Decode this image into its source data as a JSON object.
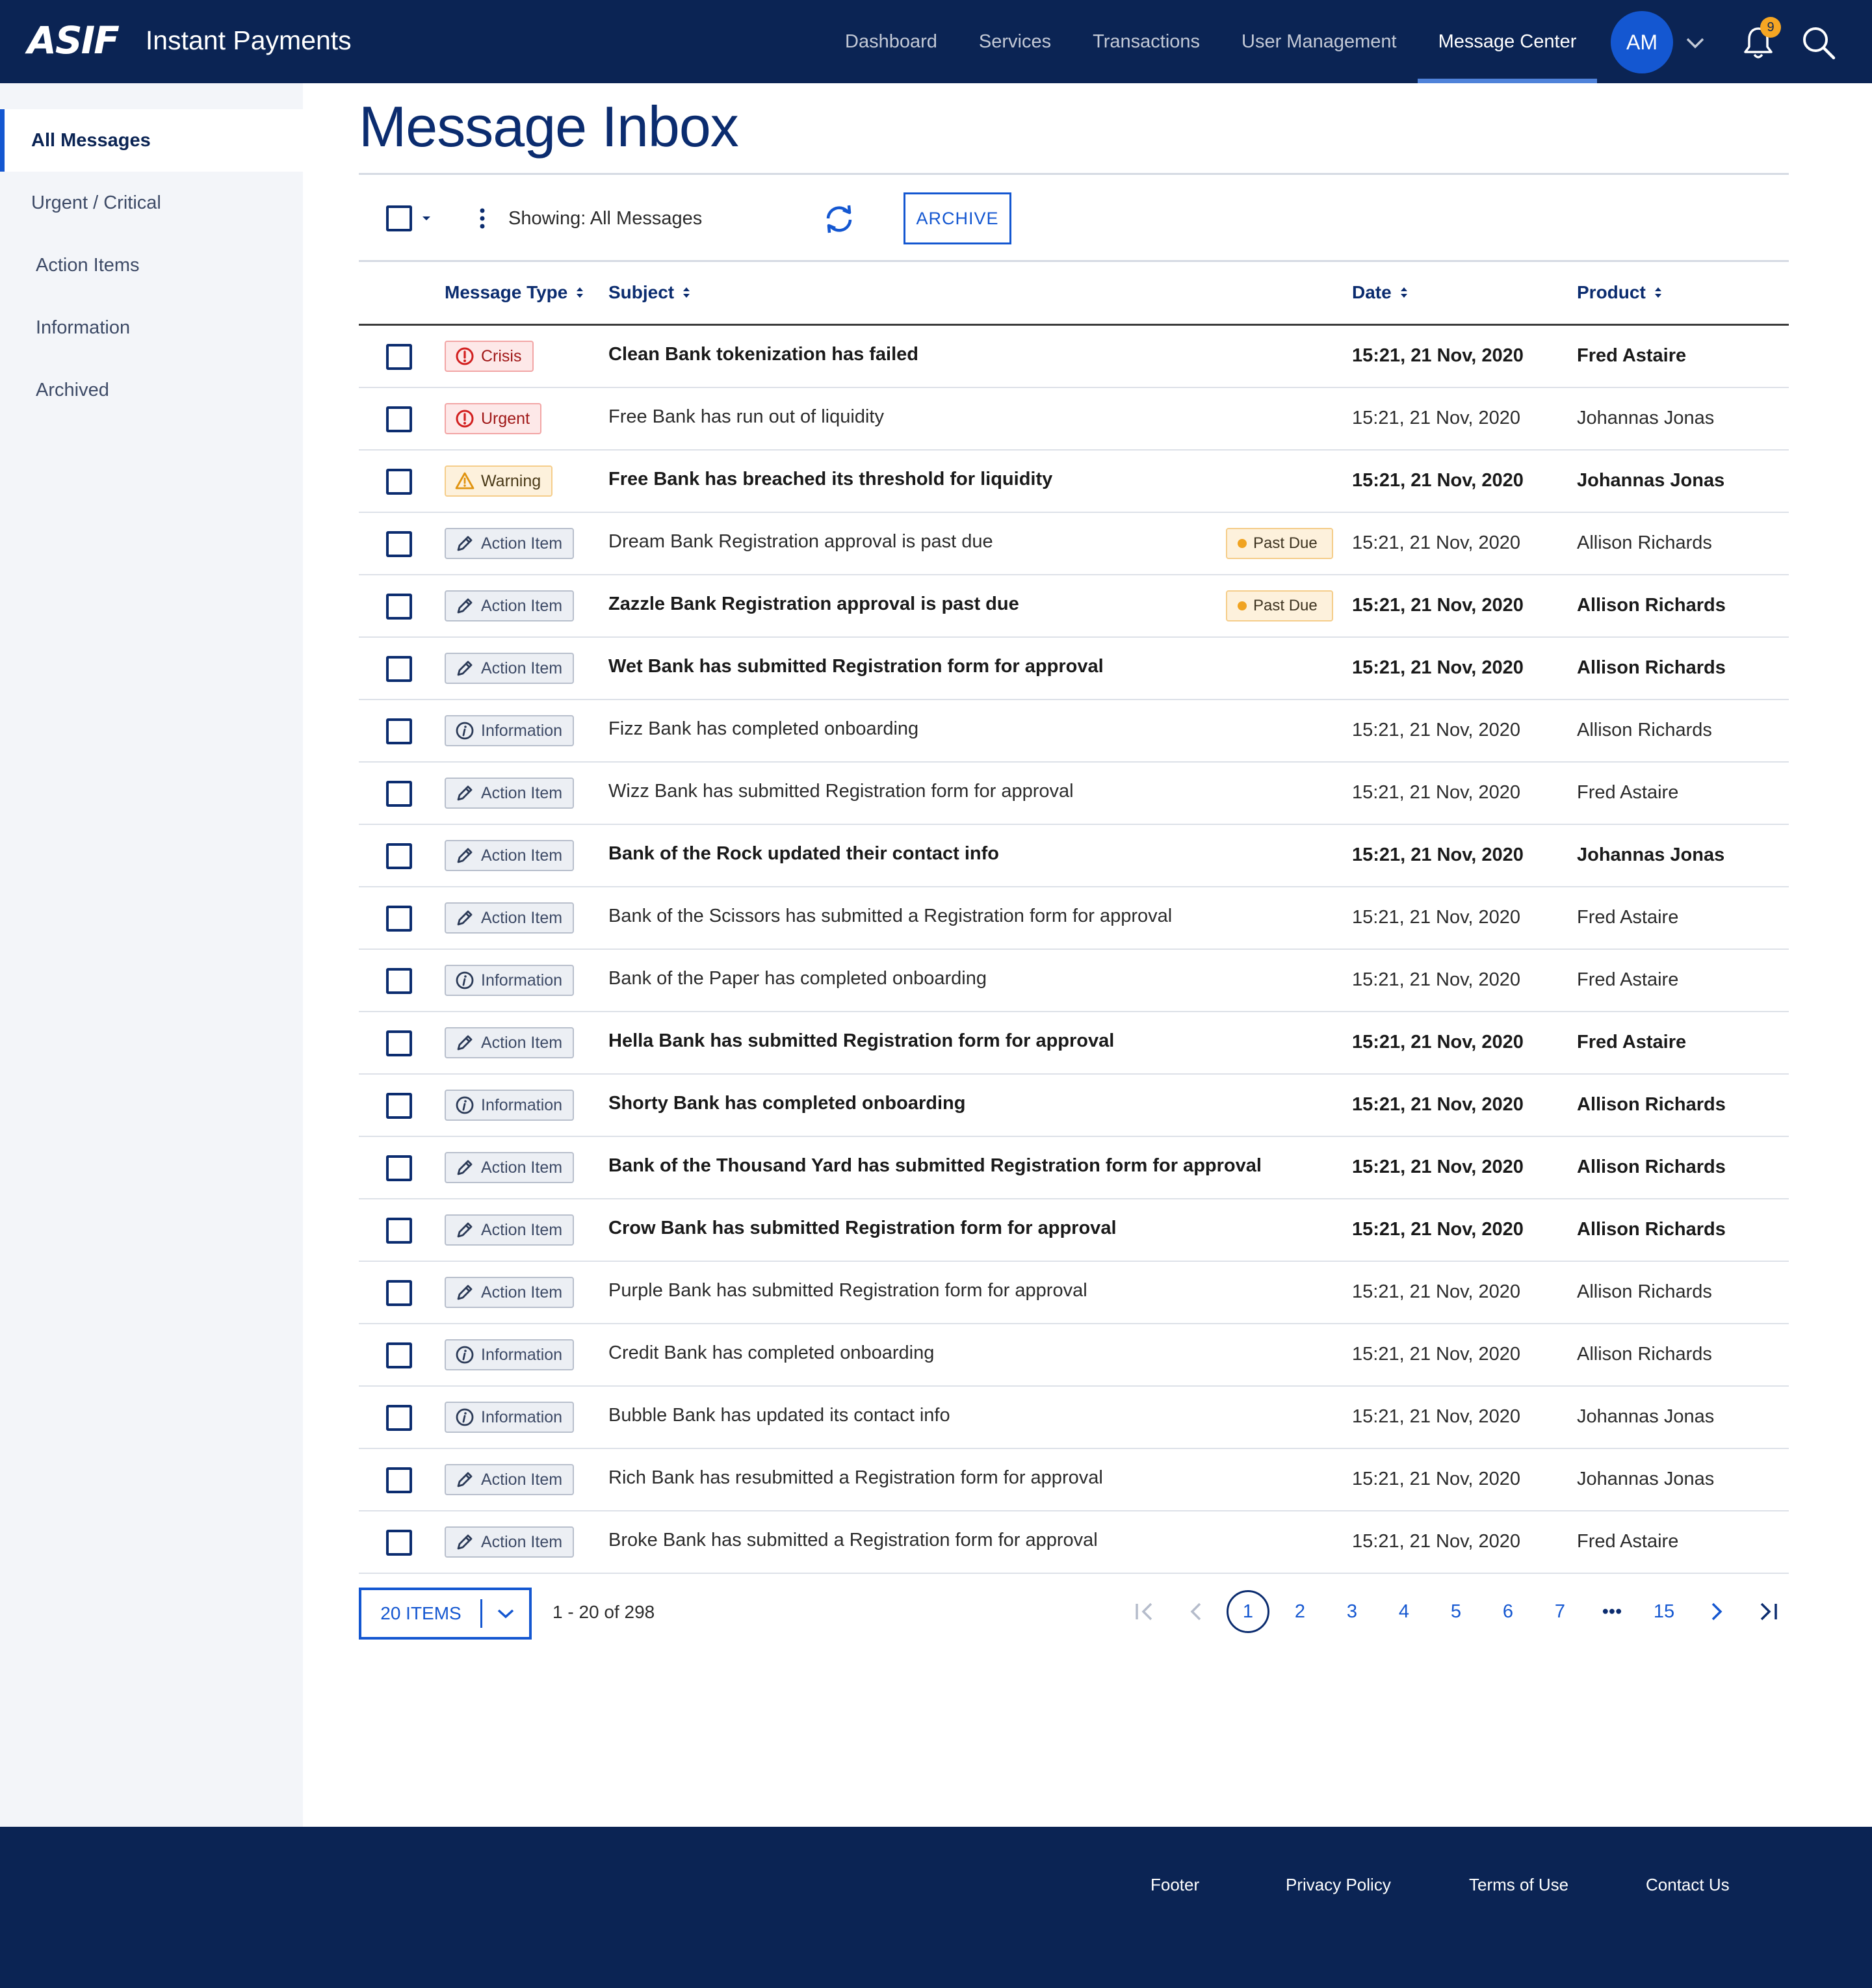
{
  "header": {
    "logo": "ASIF",
    "app_title": "Instant Payments",
    "nav": [
      "Dashboard",
      "Services",
      "Transactions",
      "User Management",
      "Message Center"
    ],
    "active_nav": "Message Center",
    "avatar_initials": "AM",
    "notification_count": "9"
  },
  "sidebar": {
    "items": [
      "All Messages",
      "Urgent / Critical",
      "Action Items",
      "Information",
      "Archived"
    ],
    "active": "All Messages"
  },
  "main": {
    "title": "Message Inbox",
    "showing": "Showing: All Messages",
    "archive_label": "ARCHIVE",
    "columns": {
      "type": "Message Type",
      "subject": "Subject",
      "date": "Date",
      "product": "Product"
    },
    "rows": [
      {
        "type": "Crisis",
        "kind": "crisis",
        "subject": "Clean Bank tokenization has failed",
        "past_due": null,
        "date": "15:21, 21 Nov, 2020",
        "product": "Fred Astaire",
        "unread": true
      },
      {
        "type": "Urgent",
        "kind": "urgent",
        "subject": "Free Bank has run out of liquidity",
        "past_due": null,
        "date": "15:21, 21 Nov, 2020",
        "product": "Johannas Jonas",
        "unread": false
      },
      {
        "type": "Warning",
        "kind": "warning",
        "subject": "Free Bank has breached its threshold for liquidity",
        "past_due": null,
        "date": "15:21, 21 Nov, 2020",
        "product": "Johannas Jonas",
        "unread": true
      },
      {
        "type": "Action Item",
        "kind": "action",
        "subject": "Dream Bank Registration approval is past due",
        "past_due": "Past Due",
        "date": "15:21, 21 Nov, 2020",
        "product": "Allison Richards",
        "unread": false
      },
      {
        "type": "Action Item",
        "kind": "action",
        "subject": "Zazzle Bank Registration approval is past due",
        "past_due": "Past Due",
        "date": "15:21, 21 Nov, 2020",
        "product": "Allison Richards",
        "unread": true
      },
      {
        "type": "Action Item",
        "kind": "action",
        "subject": "Wet Bank has submitted Registration form for approval",
        "past_due": null,
        "date": "15:21, 21 Nov, 2020",
        "product": "Allison Richards",
        "unread": true
      },
      {
        "type": "Information",
        "kind": "info",
        "subject": "Fizz Bank has completed onboarding",
        "past_due": null,
        "date": "15:21, 21 Nov, 2020",
        "product": "Allison Richards",
        "unread": false
      },
      {
        "type": "Action Item",
        "kind": "action",
        "subject": "Wizz Bank has submitted Registration form for approval",
        "past_due": null,
        "date": "15:21, 21 Nov, 2020",
        "product": "Fred Astaire",
        "unread": false
      },
      {
        "type": "Action Item",
        "kind": "action",
        "subject": "Bank of the Rock updated their contact info",
        "past_due": null,
        "date": "15:21, 21 Nov, 2020",
        "product": "Johannas Jonas",
        "unread": true
      },
      {
        "type": "Action Item",
        "kind": "action",
        "subject": "Bank of the Scissors has submitted a Registration form for approval",
        "past_due": null,
        "date": "15:21, 21 Nov, 2020",
        "product": "Fred Astaire",
        "unread": false
      },
      {
        "type": "Information",
        "kind": "info",
        "subject": "Bank of the Paper has completed onboarding",
        "past_due": null,
        "date": "15:21, 21 Nov, 2020",
        "product": "Fred Astaire",
        "unread": false
      },
      {
        "type": "Action Item",
        "kind": "action",
        "subject": "Hella Bank has submitted Registration form for approval",
        "past_due": null,
        "date": "15:21, 21 Nov, 2020",
        "product": "Fred Astaire",
        "unread": true
      },
      {
        "type": "Information",
        "kind": "info",
        "subject": "Shorty Bank has completed onboarding",
        "past_due": null,
        "date": "15:21, 21 Nov, 2020",
        "product": "Allison Richards",
        "unread": true
      },
      {
        "type": "Action Item",
        "kind": "action",
        "subject": "Bank of the Thousand Yard has submitted Registration form for approval",
        "past_due": null,
        "date": "15:21, 21 Nov, 2020",
        "product": "Allison Richards",
        "unread": true
      },
      {
        "type": "Action Item",
        "kind": "action",
        "subject": "Crow Bank has submitted Registration form for approval",
        "past_due": null,
        "date": "15:21, 21 Nov, 2020",
        "product": "Allison Richards",
        "unread": true
      },
      {
        "type": "Action Item",
        "kind": "action",
        "subject": "Purple Bank has submitted Registration form for approval",
        "past_due": null,
        "date": "15:21, 21 Nov, 2020",
        "product": "Allison Richards",
        "unread": false
      },
      {
        "type": "Information",
        "kind": "info",
        "subject": "Credit Bank has completed onboarding",
        "past_due": null,
        "date": "15:21, 21 Nov, 2020",
        "product": "Allison Richards",
        "unread": false
      },
      {
        "type": "Information",
        "kind": "info",
        "subject": "Bubble Bank has updated its contact info",
        "past_due": null,
        "date": "15:21, 21 Nov, 2020",
        "product": "Johannas Jonas",
        "unread": false
      },
      {
        "type": "Action Item",
        "kind": "action",
        "subject": "Rich Bank has resubmitted a Registration form for approval",
        "past_due": null,
        "date": "15:21, 21 Nov, 2020",
        "product": "Johannas Jonas",
        "unread": false
      },
      {
        "type": "Action Item",
        "kind": "action",
        "subject": "Broke Bank has submitted a Registration form for approval",
        "past_due": null,
        "date": "15:21, 21 Nov, 2020",
        "product": "Fred Astaire",
        "unread": false
      }
    ]
  },
  "pagination": {
    "items_label": "20 ITEMS",
    "range": "1 - 20 of 298",
    "pages": [
      "1",
      "2",
      "3",
      "4",
      "5",
      "6",
      "7",
      "•••",
      "15"
    ],
    "current": "1"
  },
  "footer": {
    "links": [
      "Footer",
      "Privacy Policy",
      "Terms of Use",
      "Contact Us"
    ]
  },
  "colors": {
    "navy": "#0b2454",
    "primary": "#1457d1",
    "crisis": "#d21f1f",
    "warning": "#f0a321",
    "sidebar_bg": "#f3f5f9"
  },
  "icons": {
    "crisis": "alert-circle-icon",
    "urgent": "alert-circle-icon",
    "warning": "warning-triangle-icon",
    "action": "pencil-icon",
    "info": "info-circle-icon"
  }
}
